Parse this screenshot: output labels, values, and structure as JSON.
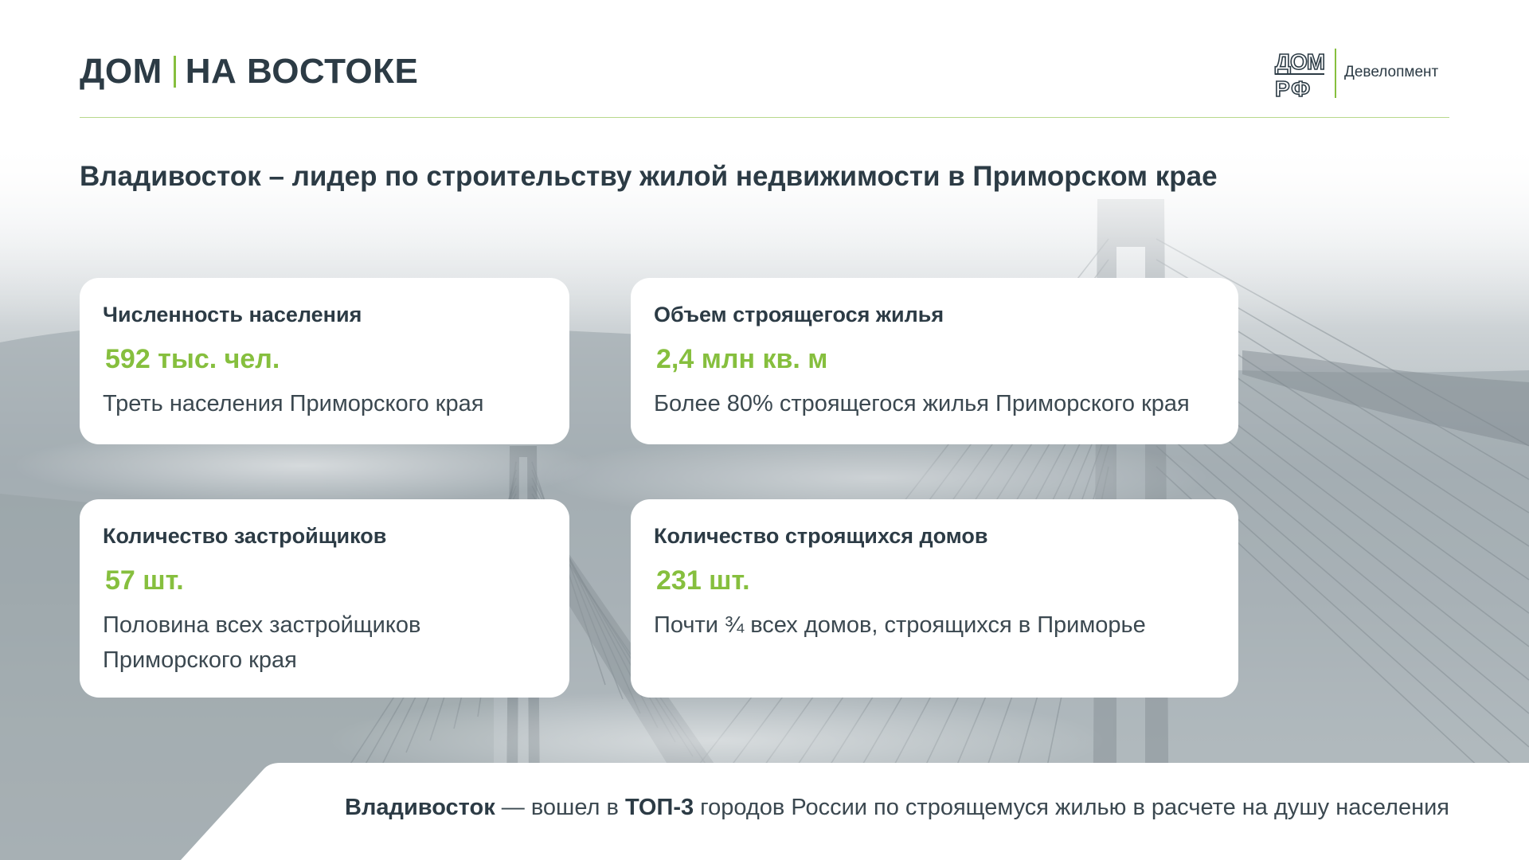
{
  "header": {
    "brand_left": "ДОМ",
    "brand_right": "НА ВОСТОКЕ"
  },
  "logo": {
    "line1": "ДОМ",
    "line2": "РФ",
    "caption": "Девелопмент"
  },
  "title": "Владивосток – лидер по строительству жилой недвижимости в Приморском крае",
  "cards": [
    {
      "heading": "Численность населения",
      "value": "592 тыс. чел.",
      "description": "Треть населения Приморского края"
    },
    {
      "heading": "Объем строящегося жилья",
      "value": "2,4 млн кв. м",
      "description": "Более 80% строящегося жилья Приморского края"
    },
    {
      "heading": "Количество застройщиков",
      "value": "57 шт.",
      "description": "Половина всех застройщиков Приморского края"
    },
    {
      "heading": "Количество строящихся домов",
      "value": "231 шт.",
      "description": "Почти ¾ всех домов, строящихся в Приморье"
    }
  ],
  "footer": {
    "city": "Владивосток",
    "text_a": " — вошел в ",
    "rank": "ТОП-3",
    "text_b": " городов России по строящемуся жилью в расчете на душу населения"
  },
  "colors": {
    "accent": "#86bf3e",
    "text": "#2c3b45",
    "card_background": "#ffffff"
  },
  "background": {
    "photo_subject": "foggy cable-stayed bridge"
  }
}
